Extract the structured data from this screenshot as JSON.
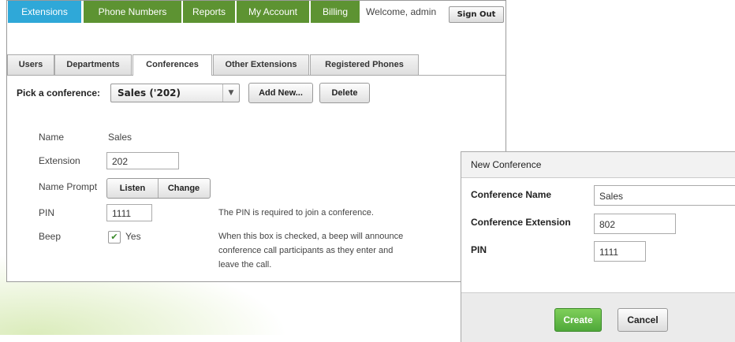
{
  "nav": {
    "extensions": "Extensions",
    "phone_numbers": "Phone Numbers",
    "reports": "Reports",
    "my_account": "My Account",
    "billing": "Billing",
    "welcome": "Welcome, admin",
    "sign_out": "Sign Out"
  },
  "tabs": {
    "users": "Users",
    "departments": "Departments",
    "conferences": "Conferences",
    "other_extensions": "Other Extensions",
    "registered_phones": "Registered Phones"
  },
  "picker": {
    "label": "Pick a conference:",
    "selected": "Sales ('202)",
    "add_new": "Add New...",
    "delete": "Delete"
  },
  "form": {
    "name_label": "Name",
    "name_value": "Sales",
    "extension_label": "Extension",
    "extension_value": "202",
    "name_prompt_label": "Name Prompt",
    "listen": "Listen",
    "change": "Change",
    "pin_label": "PIN",
    "pin_value": "1111",
    "pin_help": "The PIN is required to join a conference.",
    "beep_label": "Beep",
    "beep_value": "Yes",
    "beep_checked": true,
    "beep_help": "When this box is checked, a beep will announce conference call participants as they enter and leave the call."
  },
  "dialog": {
    "title": "New Conference",
    "conf_name_label": "Conference Name",
    "conf_name_value": "Sales",
    "conf_ext_label": "Conference Extension",
    "conf_ext_value": "802",
    "pin_label": "PIN",
    "pin_value": "1111",
    "create": "Create",
    "cancel": "Cancel"
  },
  "colors": {
    "nav_active": "#2fa8d8",
    "nav_green": "#5d9332",
    "create_green": "#4fa83a"
  }
}
